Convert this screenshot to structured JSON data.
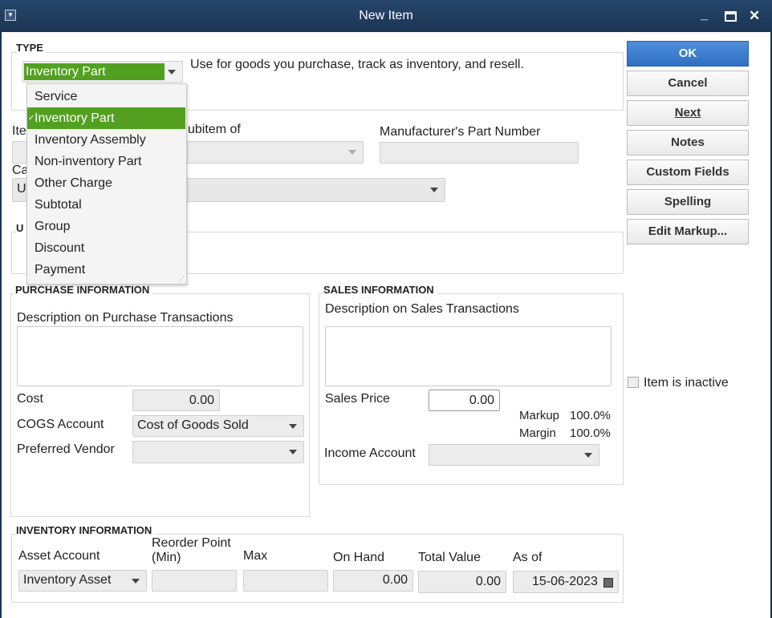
{
  "window": {
    "title": "New Item",
    "menu_icon": "system-menu-icon",
    "minimize": "_",
    "maximize": "□",
    "close": "✕"
  },
  "type": {
    "label": "TYPE",
    "selected": "Inventory Part",
    "description": "Use for goods you purchase, track as inventory, and resell.",
    "options": [
      "Service",
      "Inventory Part",
      "Inventory Assembly",
      "Non-inventory Part",
      "Other Charge",
      "Subtotal",
      "Group",
      "Discount",
      "Payment"
    ],
    "accent": "#53a020"
  },
  "item": {
    "name_label_partial": "Ite",
    "subitem_label_partial": "ubitem of",
    "mpn_label": "Manufacturer's Part Number",
    "row2_label_partial": "Ca",
    "row2_value_partial": "U",
    "group2_label_partial": "U"
  },
  "buttons": {
    "ok": "OK",
    "cancel": "Cancel",
    "next": "Next",
    "notes": "Notes",
    "custom_fields": "Custom Fields",
    "spelling": "Spelling",
    "edit_markup": "Edit Markup..."
  },
  "purchase": {
    "header": "PURCHASE INFORMATION",
    "desc_label": "Description on Purchase Transactions",
    "cost_label": "Cost",
    "cost": "0.00",
    "cogs_label": "COGS Account",
    "cogs": "Cost of Goods Sold",
    "vendor_label": "Preferred Vendor",
    "vendor": ""
  },
  "sales": {
    "header": "SALES INFORMATION",
    "desc_label": "Description on Sales Transactions",
    "price_label": "Sales Price",
    "price": "0.00",
    "markup_label": "Markup",
    "markup": "100.0%",
    "margin_label": "Margin",
    "margin": "100.0%",
    "income_label": "Income Account",
    "income": ""
  },
  "inactive": {
    "label": "Item is inactive",
    "checked": false
  },
  "inventory": {
    "header": "INVENTORY INFORMATION",
    "asset_label": "Asset Account",
    "asset": "Inventory Asset",
    "reorder_label_1": "Reorder Point",
    "reorder_label_2": "(Min)",
    "max_label": "Max",
    "onhand_label": "On Hand",
    "onhand": "0.00",
    "total_label": "Total Value",
    "total": "0.00",
    "asof_label": "As of",
    "asof": "15-06-2023"
  }
}
